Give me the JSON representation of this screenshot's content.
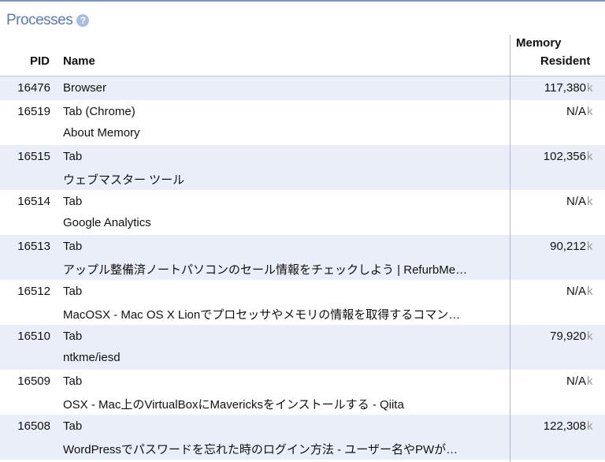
{
  "section": {
    "title": "Processes",
    "help_glyph": "?"
  },
  "columns": {
    "pid": "PID",
    "name": "Name",
    "memory": "Memory",
    "resident": "Resident"
  },
  "unit": "k",
  "rows": [
    {
      "pid": "16476",
      "type": "Browser",
      "title": "",
      "memory": "117,380"
    },
    {
      "pid": "16519",
      "type": "Tab (Chrome)",
      "title": "About Memory",
      "memory": "N/A"
    },
    {
      "pid": "16515",
      "type": "Tab",
      "title": "ウェブマスター ツール",
      "memory": "102,356"
    },
    {
      "pid": "16514",
      "type": "Tab",
      "title": "Google Analytics",
      "memory": "N/A"
    },
    {
      "pid": "16513",
      "type": "Tab",
      "title": "アップル整備済ノートパソコンのセール情報をチェックしよう | RefurbMe…",
      "memory": "90,212"
    },
    {
      "pid": "16512",
      "type": "Tab",
      "title": "MacOSX - Mac OS X Lionでプロセッサやメモリの情報を取得するコマン…",
      "memory": "N/A"
    },
    {
      "pid": "16510",
      "type": "Tab",
      "title": "ntkme/iesd",
      "memory": "79,920"
    },
    {
      "pid": "16509",
      "type": "Tab",
      "title": "OSX - Mac上のVirtualBoxにMavericksをインストールする - Qiita",
      "memory": "N/A"
    },
    {
      "pid": "16508",
      "type": "Tab",
      "title": "WordPressでパスワードを忘れた時のログイン方法 - ユーザー名やPWが…",
      "memory": "122,308"
    }
  ]
}
